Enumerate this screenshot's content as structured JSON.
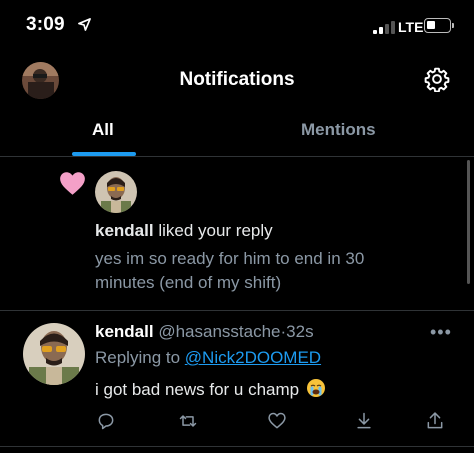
{
  "status_bar": {
    "time": "3:09",
    "network": "LTE",
    "icons": [
      "location-arrow-icon",
      "signal-icon",
      "battery-icon"
    ]
  },
  "header": {
    "title": "Notifications",
    "left_avatar": "profile-avatar",
    "right_icon": "gear-icon"
  },
  "tabs": [
    {
      "label": "All",
      "active": true
    },
    {
      "label": "Mentions",
      "active": false
    }
  ],
  "notifications": [
    {
      "type": "like",
      "icon": "heart-icon",
      "user": "kendall",
      "action_text": "liked your reply",
      "liked_content": "yes im so ready for him to end in 30 minutes (end of my shift)"
    }
  ],
  "tweet": {
    "display_name": "kendall",
    "handle": "@hasansstache",
    "separator": "·",
    "time": "32s",
    "replying_prefix": "Replying to",
    "replying_to": "@Nick2DOOMED",
    "text": "i got bad news for u champ",
    "emoji": "crying-face-emoji",
    "more_label": "•••",
    "actions": [
      "reply-icon",
      "retweet-icon",
      "like-icon",
      "bookmark-icon",
      "share-icon"
    ]
  },
  "colors": {
    "background": "#000000",
    "accent": "#1d9bf0",
    "muted_text": "#8b98a5",
    "heart": "#f4a0c8"
  }
}
